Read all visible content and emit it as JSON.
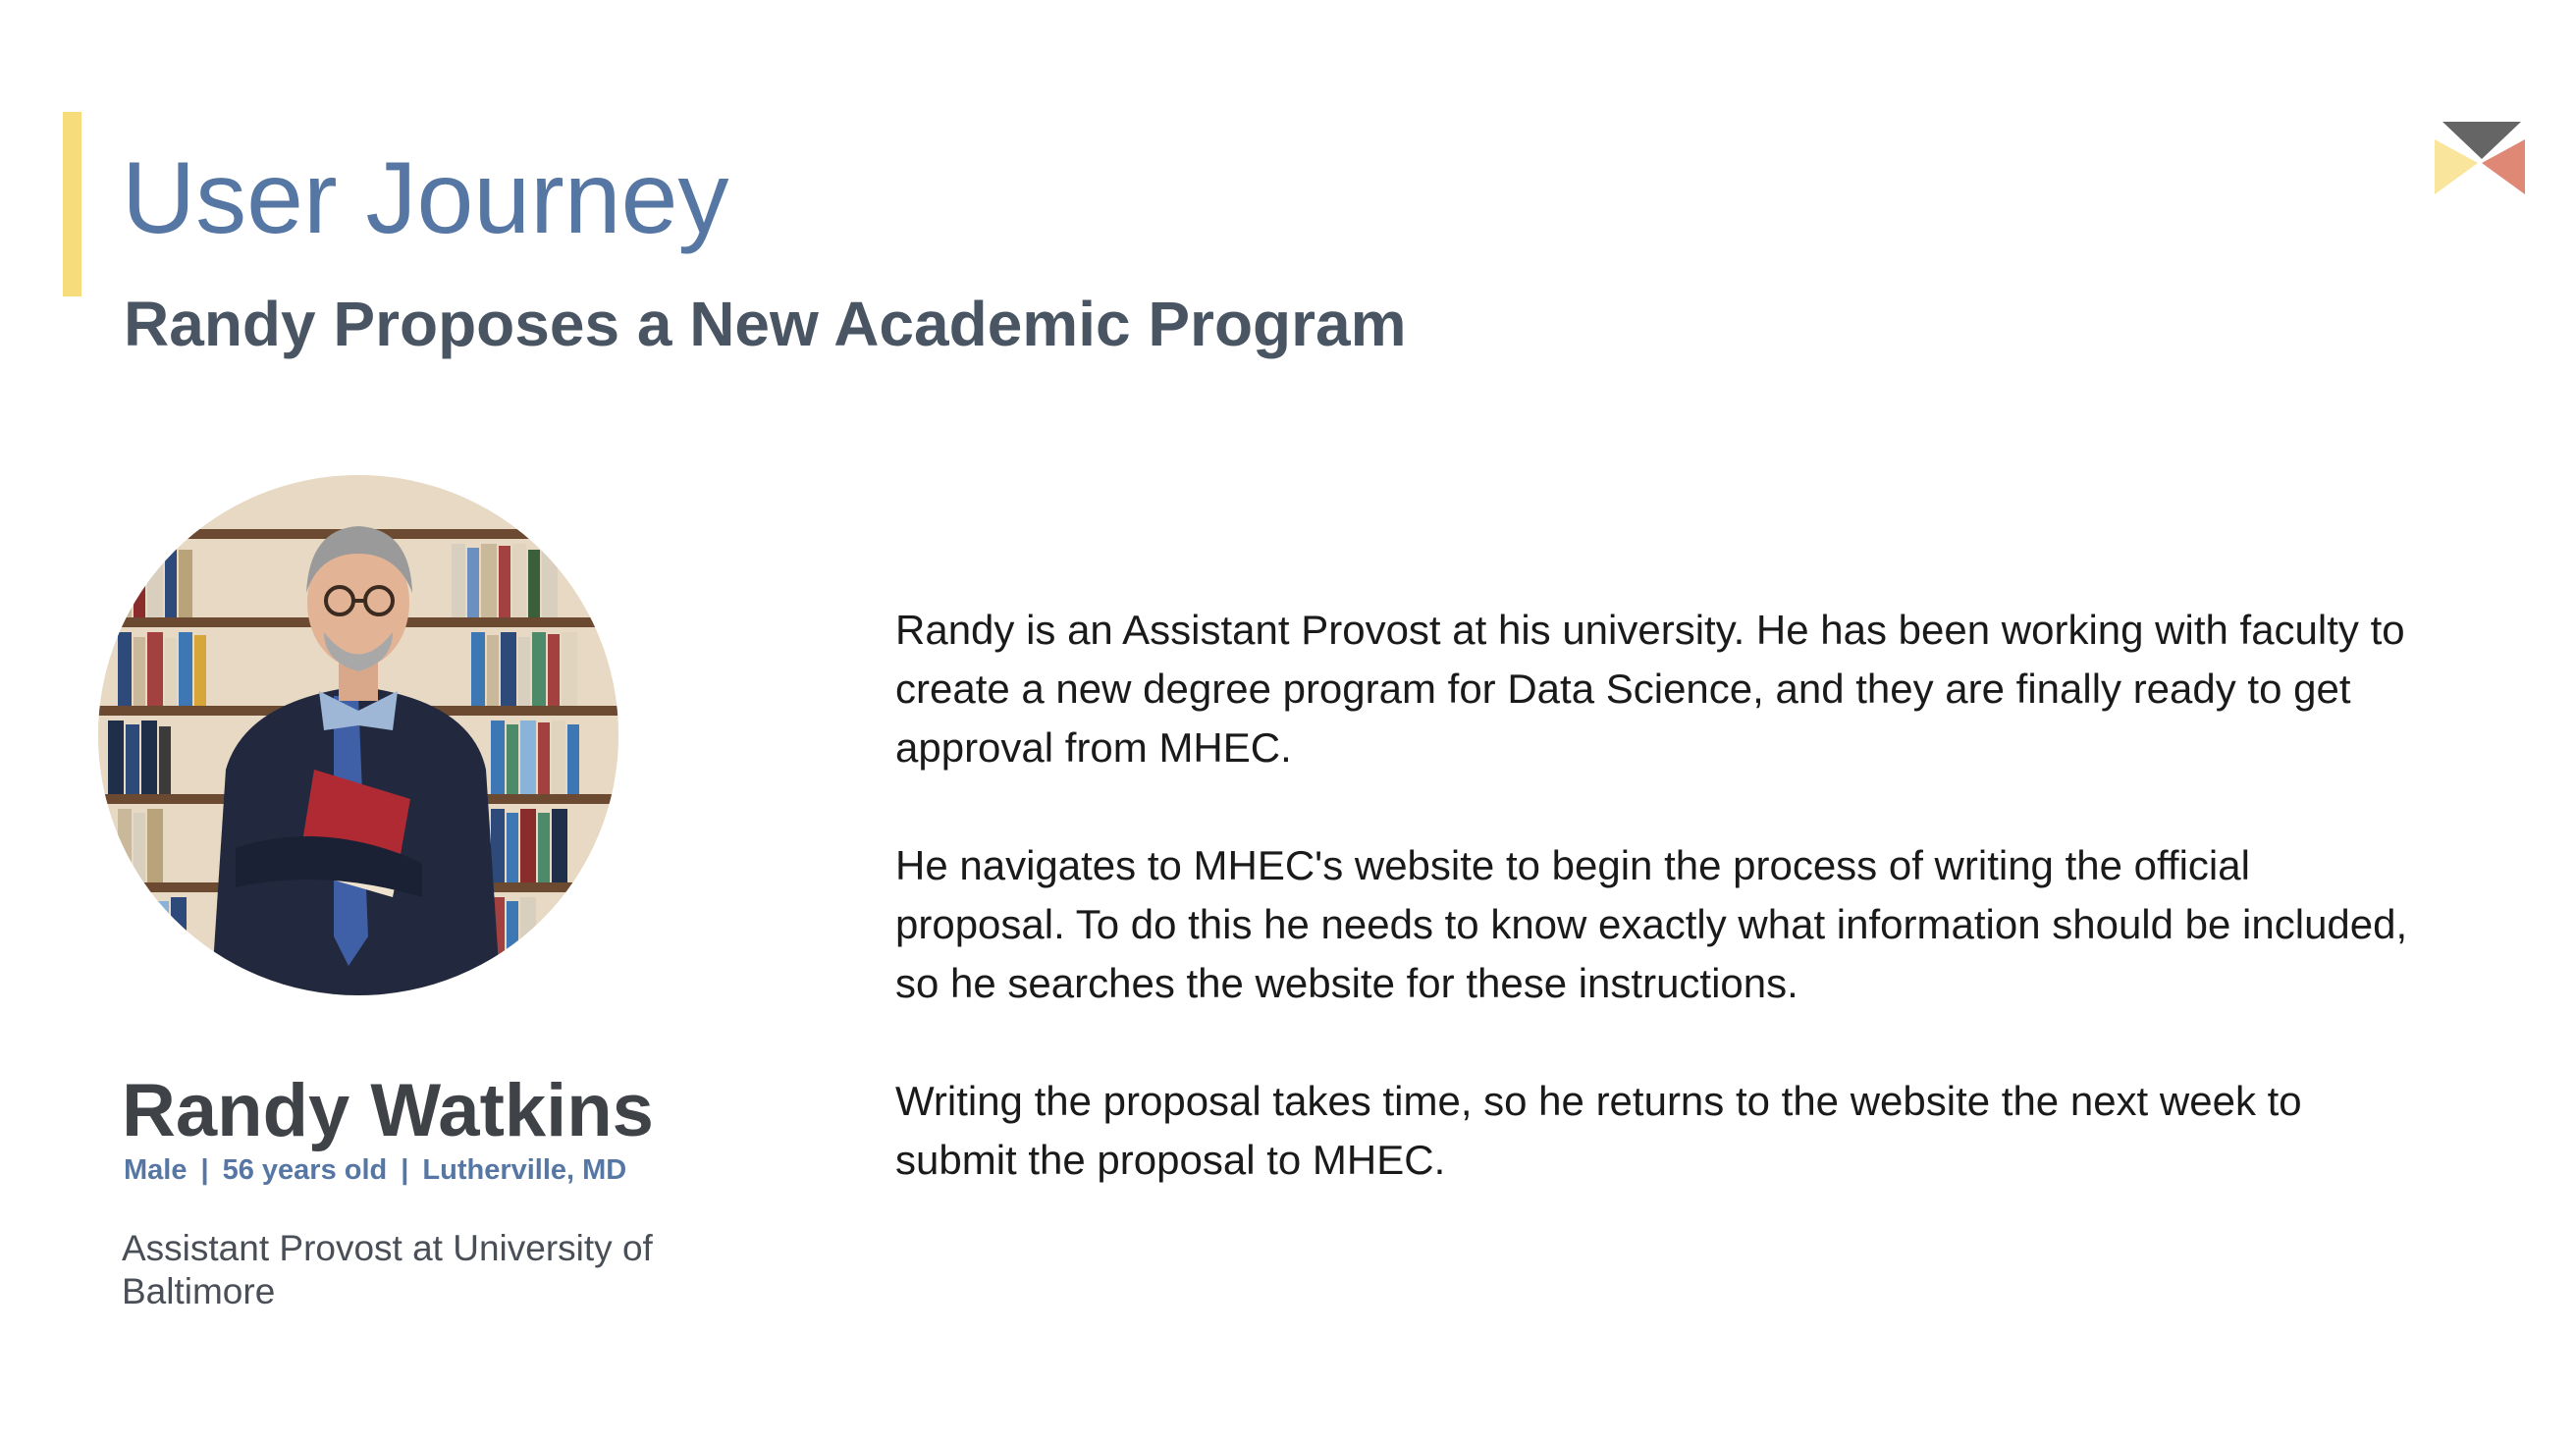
{
  "slide": {
    "title": "User Journey",
    "subtitle": "Randy Proposes a New Academic Program",
    "accent_color": "#f7dc7b",
    "title_color": "#5676a3"
  },
  "persona": {
    "name": "Randy Watkins",
    "gender": "Male",
    "age": "56 years old",
    "location": "Lutherville, MD",
    "separator": "|",
    "role": "Assistant Provost at University of Baltimore",
    "photo_icon": "persona-photo"
  },
  "story": {
    "paragraphs": [
      "Randy is an Assistant Provost at his university. He has been working with faculty to create a new degree program for Data Science, and they are finally ready to get approval from MHEC.",
      "He navigates to MHEC's website to begin the process of writing the official proposal. To do this he needs to know exactly what information should be included, so he searches the website for these instructions.",
      "Writing the proposal takes time, so he returns to the website the next week to submit the proposal to MHEC."
    ]
  },
  "logo": {
    "icon": "brand-logo-icon",
    "colors": [
      "#f7dc7b",
      "#d9735e",
      "#4a4a4a"
    ]
  }
}
